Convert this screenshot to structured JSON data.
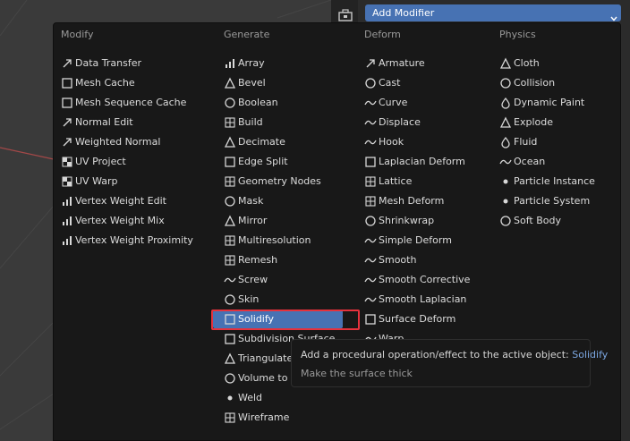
{
  "header": {
    "add_modifier_label": "Add Modifier"
  },
  "colors": {
    "accent": "#4772b3",
    "menu_bg": "#181818",
    "highlight_outline": "#e5323d",
    "tooltip_name": "#7ba6e0"
  },
  "columns": [
    {
      "header": "Modify",
      "items": [
        {
          "label": "Data Transfer",
          "icon": "data-transfer-icon"
        },
        {
          "label": "Mesh Cache",
          "icon": "mesh-cache-icon"
        },
        {
          "label": "Mesh Sequence Cache",
          "icon": "mesh-sequence-cache-icon"
        },
        {
          "label": "Normal Edit",
          "icon": "normal-edit-icon"
        },
        {
          "label": "Weighted Normal",
          "icon": "weighted-normal-icon"
        },
        {
          "label": "UV Project",
          "icon": "uv-project-icon"
        },
        {
          "label": "UV Warp",
          "icon": "uv-warp-icon"
        },
        {
          "label": "Vertex Weight Edit",
          "icon": "vertex-weight-edit-icon"
        },
        {
          "label": "Vertex Weight Mix",
          "icon": "vertex-weight-mix-icon"
        },
        {
          "label": "Vertex Weight Proximity",
          "icon": "vertex-weight-proximity-icon"
        }
      ]
    },
    {
      "header": "Generate",
      "items": [
        {
          "label": "Array",
          "icon": "array-icon"
        },
        {
          "label": "Bevel",
          "icon": "bevel-icon"
        },
        {
          "label": "Boolean",
          "icon": "boolean-icon"
        },
        {
          "label": "Build",
          "icon": "build-icon"
        },
        {
          "label": "Decimate",
          "icon": "decimate-icon"
        },
        {
          "label": "Edge Split",
          "icon": "edge-split-icon"
        },
        {
          "label": "Geometry Nodes",
          "icon": "geometry-nodes-icon"
        },
        {
          "label": "Mask",
          "icon": "mask-icon"
        },
        {
          "label": "Mirror",
          "icon": "mirror-icon"
        },
        {
          "label": "Multiresolution",
          "icon": "multiresolution-icon"
        },
        {
          "label": "Remesh",
          "icon": "remesh-icon"
        },
        {
          "label": "Screw",
          "icon": "screw-icon"
        },
        {
          "label": "Skin",
          "icon": "skin-icon"
        },
        {
          "label": "Solidify",
          "icon": "solidify-icon",
          "active": true
        },
        {
          "label": "Subdivision Surface",
          "icon": "subdivision-surface-icon"
        },
        {
          "label": "Triangulate",
          "icon": "triangulate-icon"
        },
        {
          "label": "Volume to Mesh",
          "icon": "volume-to-mesh-icon"
        },
        {
          "label": "Weld",
          "icon": "weld-icon"
        },
        {
          "label": "Wireframe",
          "icon": "wireframe-icon"
        }
      ]
    },
    {
      "header": "Deform",
      "items": [
        {
          "label": "Armature",
          "icon": "armature-icon"
        },
        {
          "label": "Cast",
          "icon": "cast-icon"
        },
        {
          "label": "Curve",
          "icon": "curve-icon"
        },
        {
          "label": "Displace",
          "icon": "displace-icon"
        },
        {
          "label": "Hook",
          "icon": "hook-icon"
        },
        {
          "label": "Laplacian Deform",
          "icon": "laplacian-deform-icon"
        },
        {
          "label": "Lattice",
          "icon": "lattice-icon"
        },
        {
          "label": "Mesh Deform",
          "icon": "mesh-deform-icon"
        },
        {
          "label": "Shrinkwrap",
          "icon": "shrinkwrap-icon"
        },
        {
          "label": "Simple Deform",
          "icon": "simple-deform-icon"
        },
        {
          "label": "Smooth",
          "icon": "smooth-icon"
        },
        {
          "label": "Smooth Corrective",
          "icon": "smooth-corrective-icon"
        },
        {
          "label": "Smooth Laplacian",
          "icon": "smooth-laplacian-icon"
        },
        {
          "label": "Surface Deform",
          "icon": "surface-deform-icon"
        },
        {
          "label": "Warp",
          "icon": "warp-icon"
        }
      ]
    },
    {
      "header": "Physics",
      "items": [
        {
          "label": "Cloth",
          "icon": "cloth-icon"
        },
        {
          "label": "Collision",
          "icon": "collision-icon"
        },
        {
          "label": "Dynamic Paint",
          "icon": "dynamic-paint-icon"
        },
        {
          "label": "Explode",
          "icon": "explode-icon"
        },
        {
          "label": "Fluid",
          "icon": "fluid-icon"
        },
        {
          "label": "Ocean",
          "icon": "ocean-icon"
        },
        {
          "label": "Particle Instance",
          "icon": "particle-instance-icon"
        },
        {
          "label": "Particle System",
          "icon": "particle-system-icon"
        },
        {
          "label": "Soft Body",
          "icon": "soft-body-icon"
        }
      ]
    }
  ],
  "tooltip": {
    "description": "Add a procedural operation/effect to the active object:",
    "name": "Solidify",
    "detail": "Make the surface thick"
  }
}
